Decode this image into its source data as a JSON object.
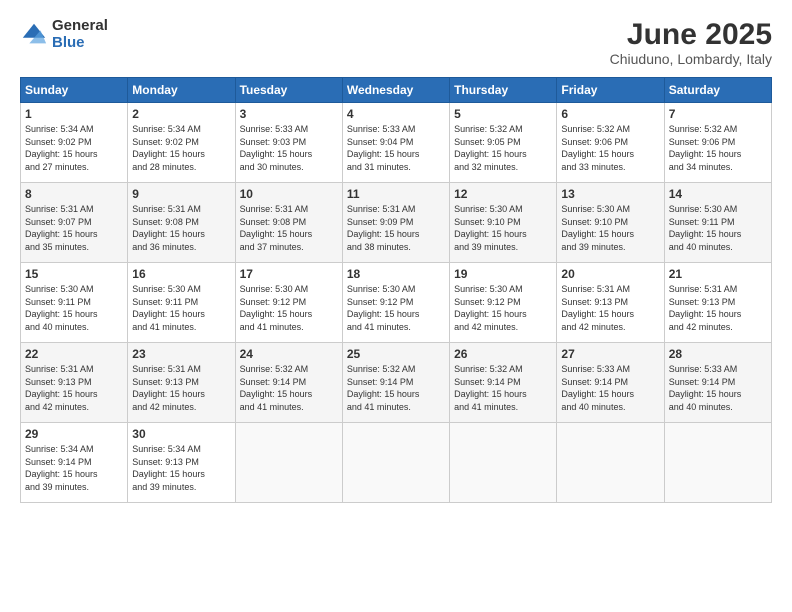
{
  "logo": {
    "general": "General",
    "blue": "Blue"
  },
  "title": "June 2025",
  "subtitle": "Chiuduno, Lombardy, Italy",
  "days_of_week": [
    "Sunday",
    "Monday",
    "Tuesday",
    "Wednesday",
    "Thursday",
    "Friday",
    "Saturday"
  ],
  "weeks": [
    [
      {
        "day": "1",
        "info": "Sunrise: 5:34 AM\nSunset: 9:02 PM\nDaylight: 15 hours\nand 27 minutes."
      },
      {
        "day": "2",
        "info": "Sunrise: 5:34 AM\nSunset: 9:02 PM\nDaylight: 15 hours\nand 28 minutes."
      },
      {
        "day": "3",
        "info": "Sunrise: 5:33 AM\nSunset: 9:03 PM\nDaylight: 15 hours\nand 30 minutes."
      },
      {
        "day": "4",
        "info": "Sunrise: 5:33 AM\nSunset: 9:04 PM\nDaylight: 15 hours\nand 31 minutes."
      },
      {
        "day": "5",
        "info": "Sunrise: 5:32 AM\nSunset: 9:05 PM\nDaylight: 15 hours\nand 32 minutes."
      },
      {
        "day": "6",
        "info": "Sunrise: 5:32 AM\nSunset: 9:06 PM\nDaylight: 15 hours\nand 33 minutes."
      },
      {
        "day": "7",
        "info": "Sunrise: 5:32 AM\nSunset: 9:06 PM\nDaylight: 15 hours\nand 34 minutes."
      }
    ],
    [
      {
        "day": "8",
        "info": "Sunrise: 5:31 AM\nSunset: 9:07 PM\nDaylight: 15 hours\nand 35 minutes."
      },
      {
        "day": "9",
        "info": "Sunrise: 5:31 AM\nSunset: 9:08 PM\nDaylight: 15 hours\nand 36 minutes."
      },
      {
        "day": "10",
        "info": "Sunrise: 5:31 AM\nSunset: 9:08 PM\nDaylight: 15 hours\nand 37 minutes."
      },
      {
        "day": "11",
        "info": "Sunrise: 5:31 AM\nSunset: 9:09 PM\nDaylight: 15 hours\nand 38 minutes."
      },
      {
        "day": "12",
        "info": "Sunrise: 5:30 AM\nSunset: 9:10 PM\nDaylight: 15 hours\nand 39 minutes."
      },
      {
        "day": "13",
        "info": "Sunrise: 5:30 AM\nSunset: 9:10 PM\nDaylight: 15 hours\nand 39 minutes."
      },
      {
        "day": "14",
        "info": "Sunrise: 5:30 AM\nSunset: 9:11 PM\nDaylight: 15 hours\nand 40 minutes."
      }
    ],
    [
      {
        "day": "15",
        "info": "Sunrise: 5:30 AM\nSunset: 9:11 PM\nDaylight: 15 hours\nand 40 minutes."
      },
      {
        "day": "16",
        "info": "Sunrise: 5:30 AM\nSunset: 9:11 PM\nDaylight: 15 hours\nand 41 minutes."
      },
      {
        "day": "17",
        "info": "Sunrise: 5:30 AM\nSunset: 9:12 PM\nDaylight: 15 hours\nand 41 minutes."
      },
      {
        "day": "18",
        "info": "Sunrise: 5:30 AM\nSunset: 9:12 PM\nDaylight: 15 hours\nand 41 minutes."
      },
      {
        "day": "19",
        "info": "Sunrise: 5:30 AM\nSunset: 9:12 PM\nDaylight: 15 hours\nand 42 minutes."
      },
      {
        "day": "20",
        "info": "Sunrise: 5:31 AM\nSunset: 9:13 PM\nDaylight: 15 hours\nand 42 minutes."
      },
      {
        "day": "21",
        "info": "Sunrise: 5:31 AM\nSunset: 9:13 PM\nDaylight: 15 hours\nand 42 minutes."
      }
    ],
    [
      {
        "day": "22",
        "info": "Sunrise: 5:31 AM\nSunset: 9:13 PM\nDaylight: 15 hours\nand 42 minutes."
      },
      {
        "day": "23",
        "info": "Sunrise: 5:31 AM\nSunset: 9:13 PM\nDaylight: 15 hours\nand 42 minutes."
      },
      {
        "day": "24",
        "info": "Sunrise: 5:32 AM\nSunset: 9:14 PM\nDaylight: 15 hours\nand 41 minutes."
      },
      {
        "day": "25",
        "info": "Sunrise: 5:32 AM\nSunset: 9:14 PM\nDaylight: 15 hours\nand 41 minutes."
      },
      {
        "day": "26",
        "info": "Sunrise: 5:32 AM\nSunset: 9:14 PM\nDaylight: 15 hours\nand 41 minutes."
      },
      {
        "day": "27",
        "info": "Sunrise: 5:33 AM\nSunset: 9:14 PM\nDaylight: 15 hours\nand 40 minutes."
      },
      {
        "day": "28",
        "info": "Sunrise: 5:33 AM\nSunset: 9:14 PM\nDaylight: 15 hours\nand 40 minutes."
      }
    ],
    [
      {
        "day": "29",
        "info": "Sunrise: 5:34 AM\nSunset: 9:14 PM\nDaylight: 15 hours\nand 39 minutes."
      },
      {
        "day": "30",
        "info": "Sunrise: 5:34 AM\nSunset: 9:13 PM\nDaylight: 15 hours\nand 39 minutes."
      },
      {
        "day": "",
        "info": ""
      },
      {
        "day": "",
        "info": ""
      },
      {
        "day": "",
        "info": ""
      },
      {
        "day": "",
        "info": ""
      },
      {
        "day": "",
        "info": ""
      }
    ]
  ]
}
